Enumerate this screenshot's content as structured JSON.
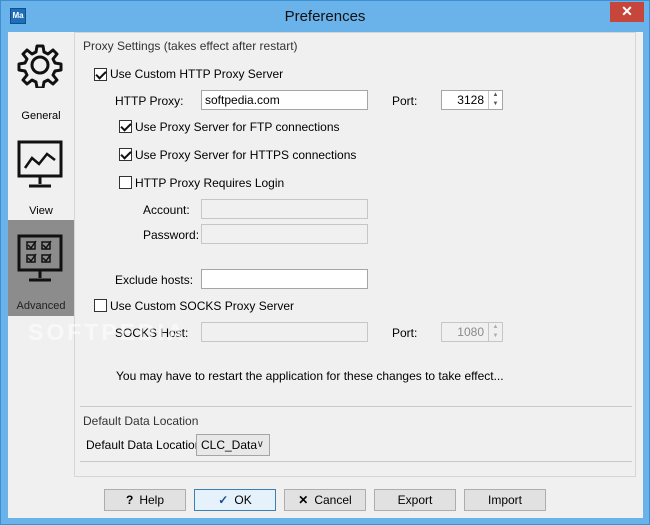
{
  "window": {
    "title": "Preferences",
    "app_icon_text": "Ma",
    "close_glyph": "✕",
    "accent_color": "#6ab2ea"
  },
  "sidebar": {
    "items": [
      {
        "label": "General",
        "icon": "gear-icon"
      },
      {
        "label": "View",
        "icon": "monitor-chart-icon"
      },
      {
        "label": "Advanced",
        "icon": "checklist-monitor-icon",
        "active": true
      }
    ]
  },
  "proxy": {
    "group_title": "Proxy Settings (takes effect after restart)",
    "use_http_label": "Use Custom HTTP Proxy Server",
    "use_http_checked": true,
    "http_proxy_label": "HTTP Proxy:",
    "http_proxy_value": "softpedia.com",
    "port_label": "Port:",
    "port_value": "3128",
    "ftp_label": "Use Proxy Server for FTP connections",
    "ftp_checked": true,
    "https_label": "Use Proxy Server for HTTPS connections",
    "https_checked": true,
    "login_label": "HTTP Proxy Requires Login",
    "login_checked": false,
    "account_label": "Account:",
    "account_value": "",
    "password_label": "Password:",
    "password_value": "",
    "exclude_label": "Exclude hosts:",
    "exclude_value": "",
    "use_socks_label": "Use Custom SOCKS Proxy Server",
    "use_socks_checked": false,
    "socks_host_label": "SOCKS Host:",
    "socks_host_value": "",
    "socks_port_label": "Port:",
    "socks_port_value": "1080",
    "restart_note": "You may have to restart the application for these changes to take effect..."
  },
  "data_location": {
    "group_title": "Default Data Location",
    "label": "Default Data Location:",
    "value": "CLC_Data"
  },
  "buttons": {
    "help": "Help",
    "help_icon": "?",
    "ok": "OK",
    "ok_icon": "✓",
    "cancel": "Cancel",
    "cancel_icon": "✕",
    "export": "Export",
    "import": "Import"
  },
  "watermark": "SOFTPEDIA"
}
